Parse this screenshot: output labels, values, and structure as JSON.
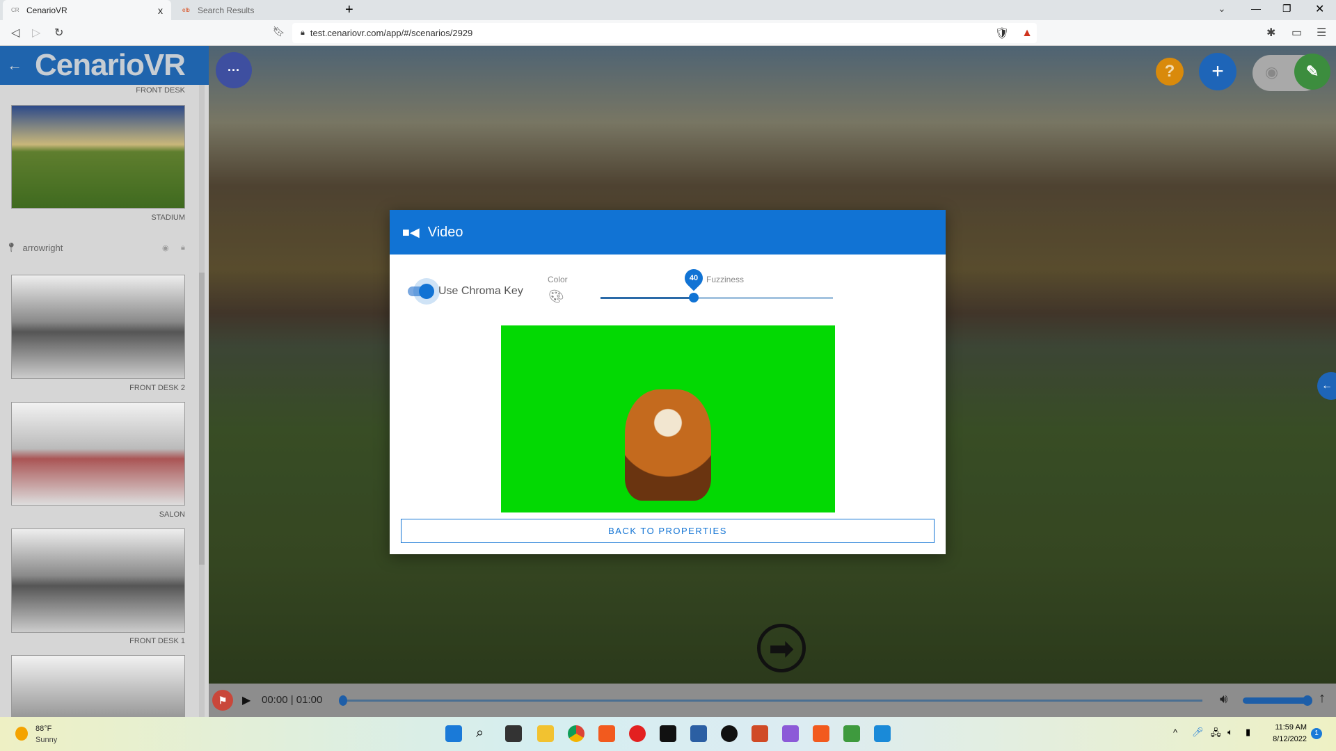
{
  "browser": {
    "tabs": [
      {
        "label": "CenarioVR",
        "favicon": "CR"
      },
      {
        "label": "Search Results",
        "favicon": "elb"
      }
    ],
    "url": "test.cenariovr.com/app/#/scenarios/2929",
    "new_tab": "+",
    "close_tab": "x"
  },
  "app": {
    "logo": "CenarioVR",
    "menu_label": "···"
  },
  "sidebar": {
    "top_label": "FRONT DESK",
    "scenes": [
      {
        "label": "STADIUM"
      },
      {
        "label": "FRONT DESK 2"
      },
      {
        "label": "SALON"
      },
      {
        "label": "FRONT DESK 1"
      },
      {
        "label": ""
      }
    ],
    "hotspot": {
      "label": "arrowright"
    }
  },
  "toolbar": {
    "help": "?",
    "add": "+"
  },
  "modal": {
    "title": "Video",
    "chroma_label": "Use Chroma Key",
    "chroma_on": true,
    "color_label": "Color",
    "fuzziness_label": "Fuzziness",
    "fuzziness_value": "40",
    "fuzziness_fraction": 0.4,
    "back_button": "BACK TO PROPERTIES",
    "chroma_color": "#03d903"
  },
  "player": {
    "time": "00:00 | 01:00",
    "progress": 0,
    "volume": 0.95
  },
  "taskbar": {
    "temp": "88°F",
    "weather": "Sunny",
    "time": "11:59 AM",
    "date": "8/12/2022",
    "notifications": "1"
  },
  "colors": {
    "accent": "#1173d4",
    "help": "#d98a0b",
    "edit": "#3c8d3e"
  }
}
